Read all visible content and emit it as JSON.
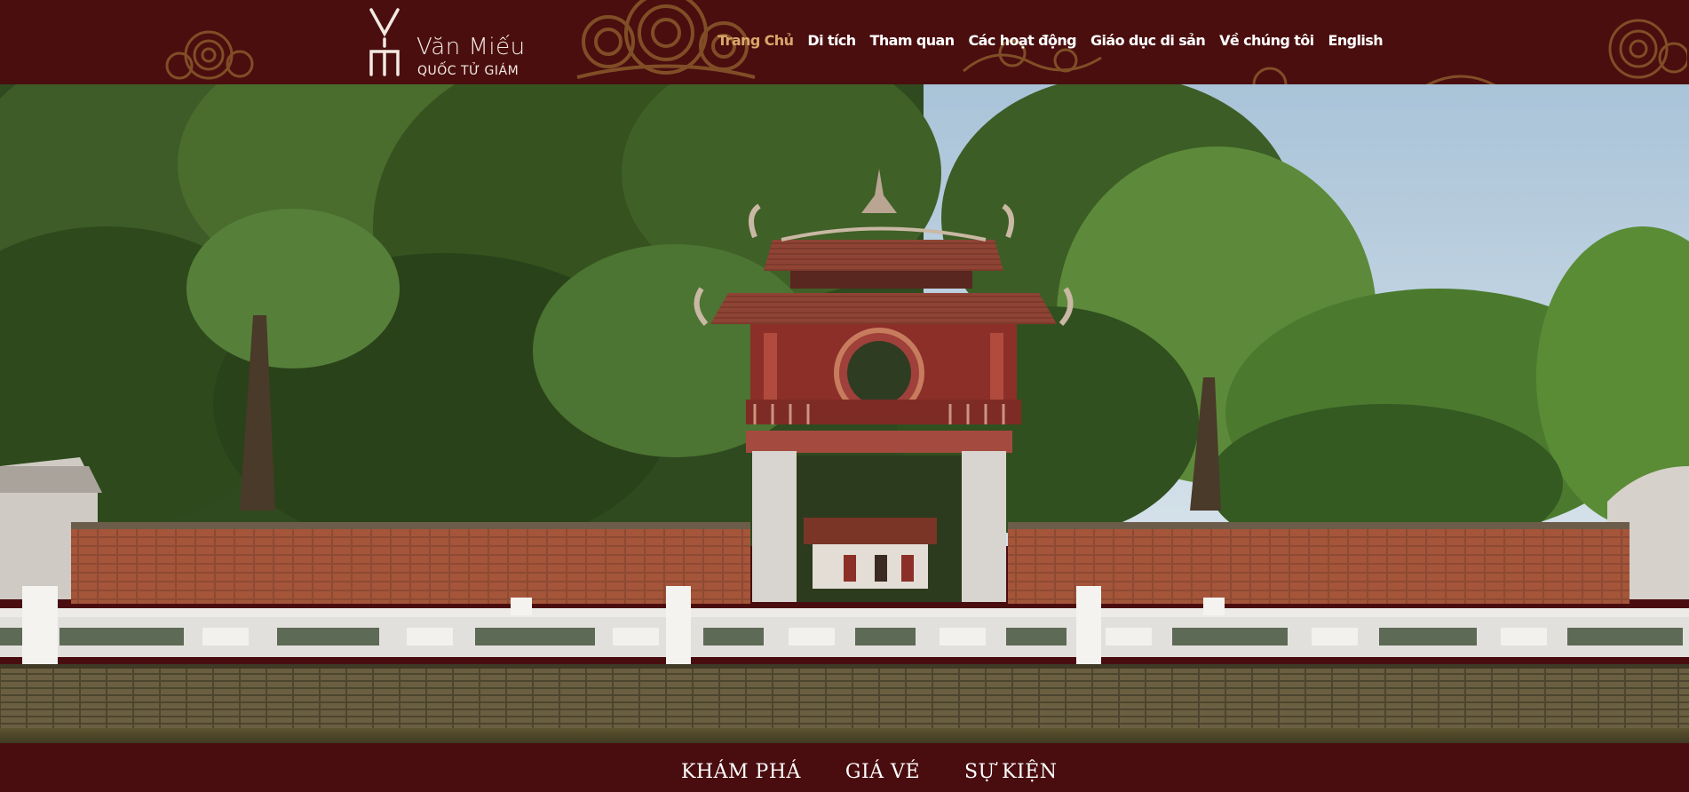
{
  "brand": {
    "title": "Văn Miếu",
    "subtitle": "QUỐC TỬ GIÁM"
  },
  "nav": [
    {
      "label": "Trang Chủ",
      "active": true
    },
    {
      "label": "Di tích",
      "active": false
    },
    {
      "label": "Tham quan",
      "active": false
    },
    {
      "label": "Các hoạt động",
      "active": false
    },
    {
      "label": "Giáo dục di sản",
      "active": false
    },
    {
      "label": "Về chúng tôi",
      "active": false
    },
    {
      "label": "English",
      "active": false
    }
  ],
  "hero": {
    "image": "khue-van-cac-pavilion-photo"
  },
  "bottom_nav": [
    "KHÁM PHÁ",
    "GIÁ VÉ",
    "SỰ KIỆN"
  ],
  "colors": {
    "header_bg": "#4a0e0f",
    "active_nav": "#d9a76a",
    "ornament": "#8a5a2b",
    "text": "#ffffff"
  }
}
